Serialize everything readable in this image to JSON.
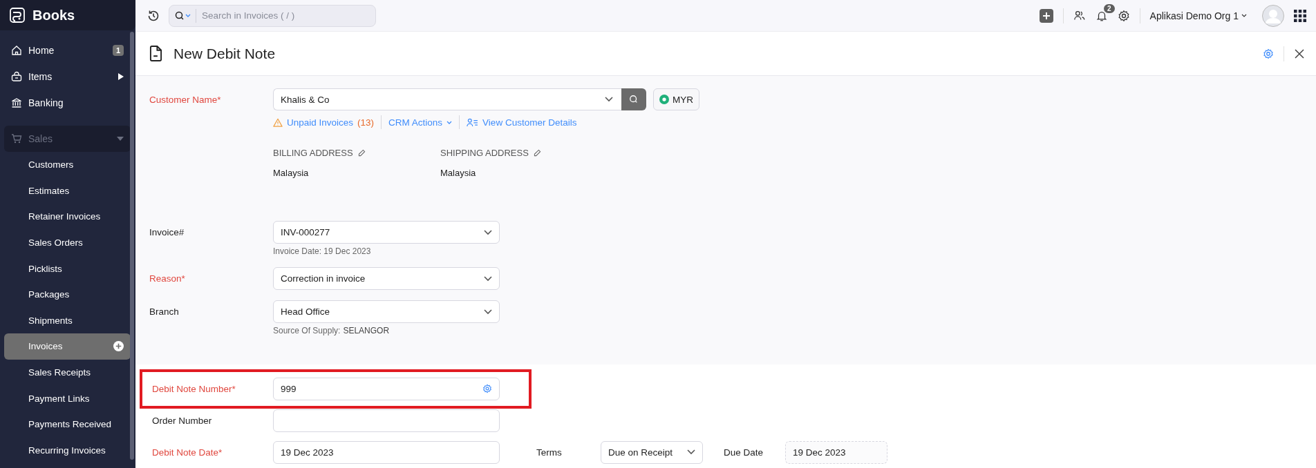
{
  "sidebar": {
    "logo": "Books",
    "items": [
      {
        "label": "Home",
        "badge": "1",
        "submenu": false
      },
      {
        "label": "Items",
        "submenu": true
      },
      {
        "label": "Banking",
        "submenu": false
      }
    ],
    "section": {
      "label": "Sales",
      "expanded": true,
      "children": [
        {
          "label": "Customers",
          "selected": false
        },
        {
          "label": "Estimates",
          "selected": false
        },
        {
          "label": "Retainer Invoices",
          "selected": false
        },
        {
          "label": "Sales Orders",
          "selected": false
        },
        {
          "label": "Picklists",
          "selected": false
        },
        {
          "label": "Packages",
          "selected": false
        },
        {
          "label": "Shipments",
          "selected": false
        },
        {
          "label": "Invoices",
          "selected": true
        },
        {
          "label": "Sales Receipts",
          "selected": false
        },
        {
          "label": "Payment Links",
          "selected": false
        },
        {
          "label": "Payments Received",
          "selected": false
        },
        {
          "label": "Recurring Invoices",
          "selected": false
        }
      ]
    }
  },
  "topbar": {
    "search": {
      "placeholder": "Search in Invoices ( / )"
    },
    "notifications": "2",
    "org": "Aplikasi Demo Org 1"
  },
  "page": {
    "title": "New Debit Note"
  },
  "customer": {
    "label": "Customer Name*",
    "required": true,
    "value": "Khalis & Co",
    "currency": "MYR",
    "links": [
      {
        "label": "Unpaid Invoices",
        "count": "(13)"
      },
      {
        "label": "CRM Actions"
      },
      {
        "label": "View Customer Details"
      }
    ],
    "addresses": [
      {
        "heading": "BILLING ADDRESS",
        "value": "Malaysia"
      },
      {
        "heading": "SHIPPING ADDRESS",
        "value": "Malaysia"
      }
    ]
  },
  "top_fields": [
    {
      "label": "Invoice#",
      "required": false,
      "kind": "select",
      "value": "INV-000277",
      "note": "Invoice Date: 19 Dec 2023"
    },
    {
      "label": "Reason*",
      "required": true,
      "kind": "select",
      "value": "Correction in invoice"
    },
    {
      "label": "Branch",
      "required": false,
      "kind": "select",
      "value": "Head Office",
      "note": "Source Of Supply:",
      "note_value": "SELANGOR"
    }
  ],
  "bottom_fields": [
    {
      "label": "Debit Note Number*",
      "required": true,
      "kind": "number",
      "value": "999",
      "highlighted": true
    },
    {
      "label": "Order Number",
      "required": false,
      "kind": "text",
      "highlighted": false
    },
    {
      "label": "Debit Note Date*",
      "required": true,
      "kind": "date",
      "value": "19 Dec 2023",
      "highlighted": false
    }
  ],
  "terms": {
    "label": "Terms",
    "value": "Due on Receipt"
  },
  "due_date": {
    "label": "Due Date",
    "value": "19 Dec 2023"
  }
}
